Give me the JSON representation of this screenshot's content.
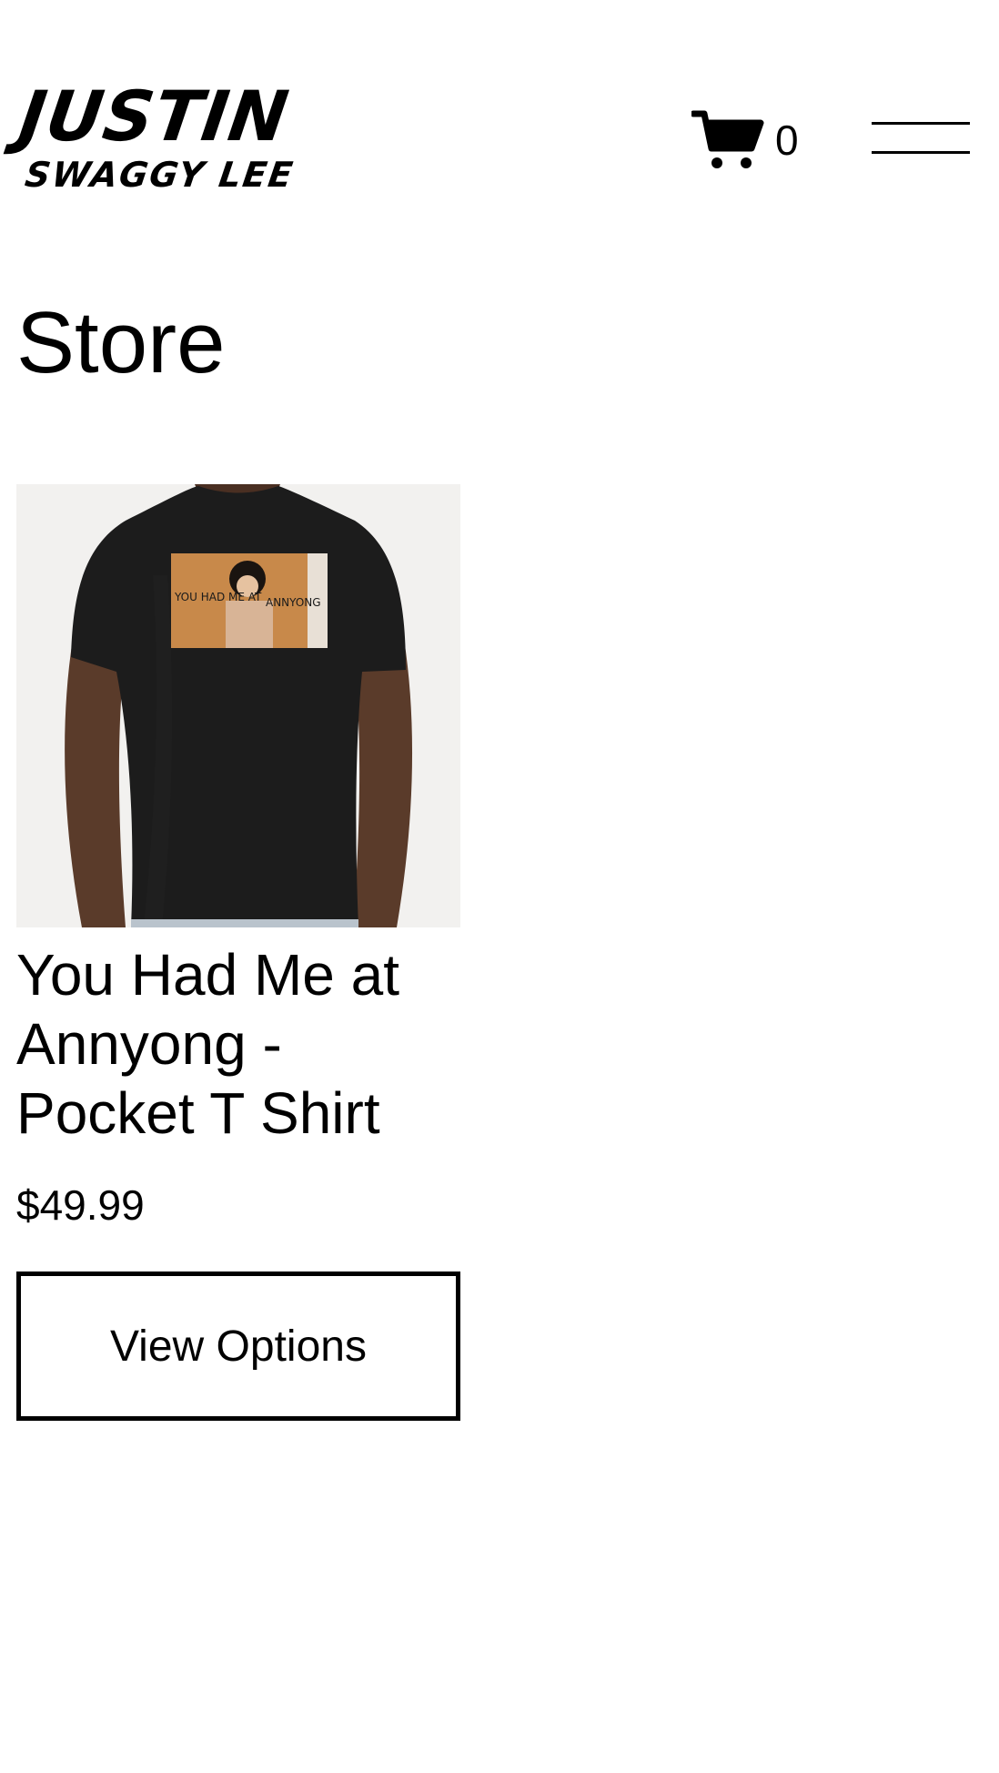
{
  "header": {
    "logo_line1": "JUSTIN",
    "logo_line2": "SWAGGY LEE",
    "cart_icon": "shopping-cart-icon",
    "cart_count": "0",
    "menu_icon": "hamburger-menu-icon"
  },
  "main": {
    "title": "Store"
  },
  "products": [
    {
      "image_print_text_left": "YOU HAD ME AT",
      "image_print_text_right": "ANNYONG",
      "name": "You Had Me at Annyong - Pocket T Shirt",
      "price": "$49.99",
      "button_label": "View Options"
    }
  ]
}
